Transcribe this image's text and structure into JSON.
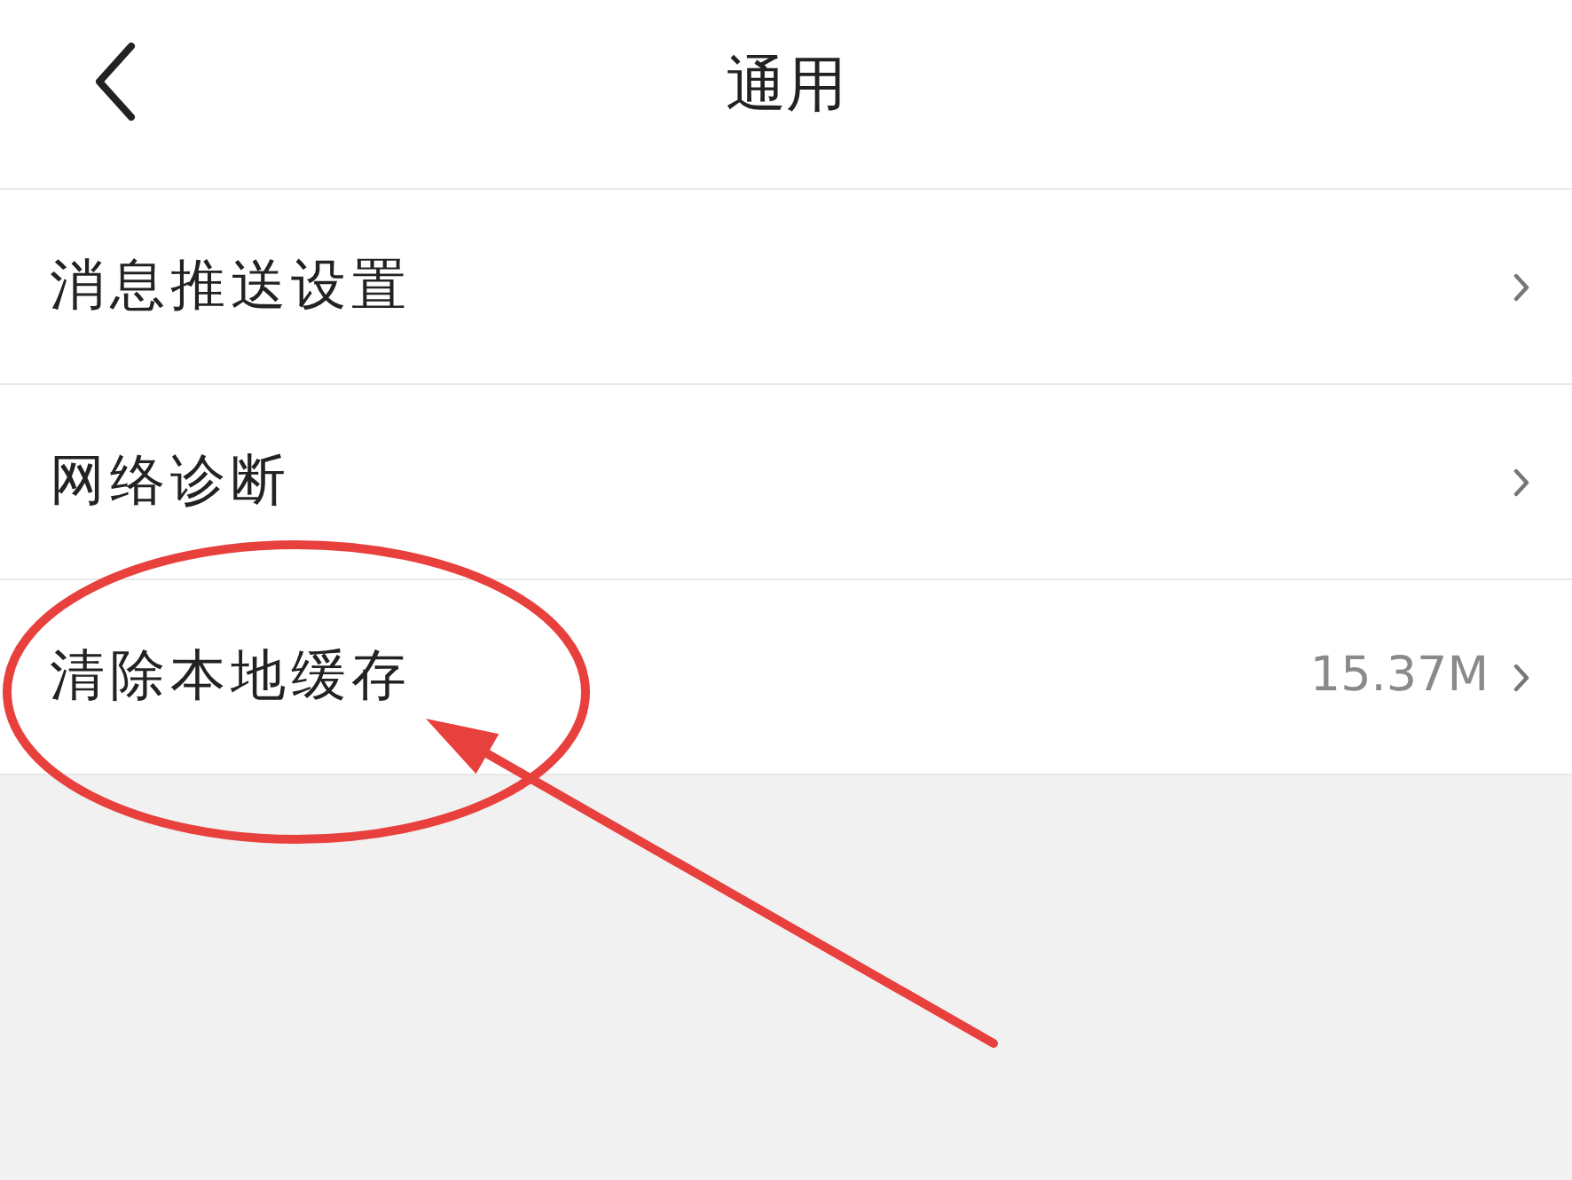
{
  "header": {
    "title": "通用"
  },
  "items": [
    {
      "label": "消息推送设置",
      "annotated": false
    },
    {
      "label": "网络诊断",
      "annotated": false
    },
    {
      "label": "清除本地缓存",
      "value": "15.37M",
      "annotated": true
    }
  ]
}
